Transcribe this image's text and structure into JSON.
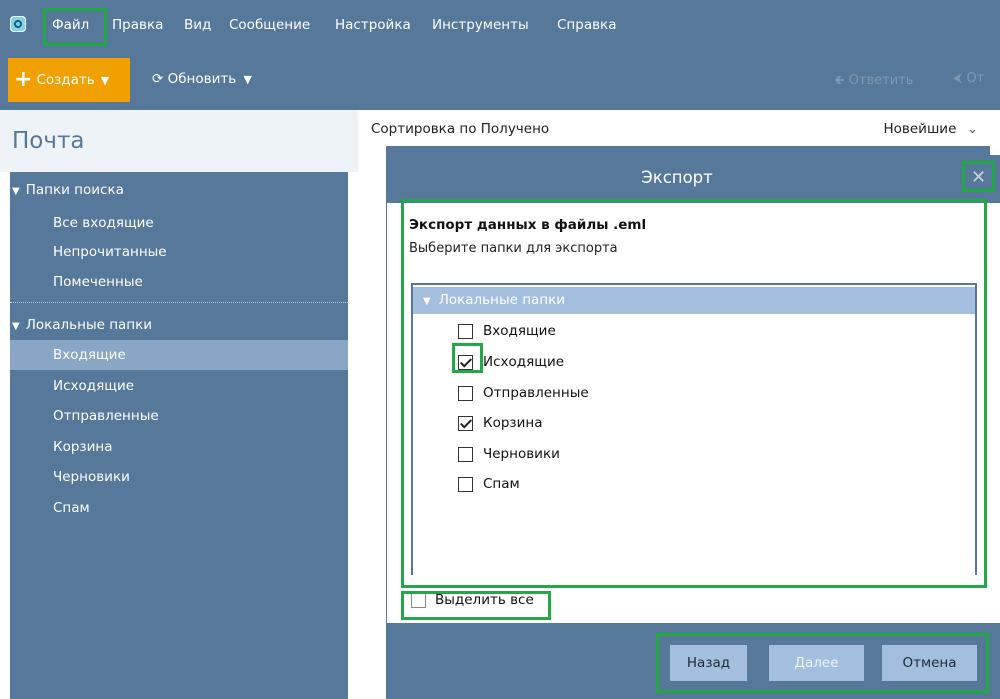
{
  "menu": {
    "items": [
      "Файл",
      "Правка",
      "Вид",
      "Сообщение",
      "Настройка",
      "Инструменты",
      "Справка"
    ]
  },
  "toolbar": {
    "create_label": "Создать",
    "refresh_label": "Обновить",
    "reply_label": "Ответить",
    "reply_all_label": "От"
  },
  "sidebar": {
    "title": "Почта",
    "search_group": "Папки поиска",
    "search_items": [
      "Все входящие",
      "Непрочитанные",
      "Помеченные"
    ],
    "local_group": "Локальные папки",
    "local_items": [
      "Входящие",
      "Исходящие",
      "Отправленные",
      "Корзина",
      "Черновики",
      "Спам"
    ],
    "selected_item": "Входящие"
  },
  "main": {
    "sort_label": "Сортировка по Получено",
    "sort_order": "Новейшие"
  },
  "dialog": {
    "title": "Экспорт",
    "close_glyph": "✕",
    "heading": "Экспорт данных в файлы .eml",
    "subheading": "Выберите папки для экспорта",
    "tree_root": "Локальные папки",
    "folders": [
      {
        "label": "Входящие",
        "checked": false
      },
      {
        "label": "Исходящие",
        "checked": true
      },
      {
        "label": "Отправленные",
        "checked": false
      },
      {
        "label": "Корзина",
        "checked": true
      },
      {
        "label": "Черновики",
        "checked": false
      },
      {
        "label": "Спам",
        "checked": false
      }
    ],
    "select_all_label": "Выделить все",
    "select_all_checked": false,
    "buttons": {
      "back": "Назад",
      "next": "Далее",
      "cancel": "Отмена"
    }
  },
  "colors": {
    "chrome": "#56789a",
    "accent_orange": "#f0a000",
    "selection": "#89a6c4",
    "tree_header": "#a3bfdd",
    "highlight_green": "#22a845"
  },
  "icons": [
    "app-icon",
    "plus-icon",
    "refresh-icon",
    "reply-icon",
    "reply-all-icon",
    "close-icon",
    "chevron-down-icon",
    "triangle-down-icon",
    "checkbox-icon"
  ]
}
